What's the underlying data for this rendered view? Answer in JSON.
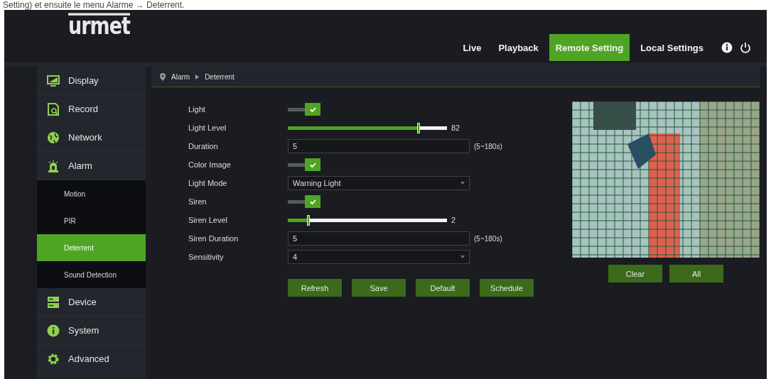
{
  "document_caption": "Setting) et ensuite le menu Alarme → Deterrent.",
  "header": {
    "logo": "urmet",
    "nav": [
      {
        "label": "Live",
        "selected": false
      },
      {
        "label": "Playback",
        "selected": false
      },
      {
        "label": "Remote Setting",
        "selected": true
      },
      {
        "label": "Local Settings",
        "selected": false
      }
    ]
  },
  "sidebar": {
    "items": [
      {
        "label": "Display",
        "selected": false
      },
      {
        "label": "Record",
        "selected": false
      },
      {
        "label": "Network",
        "selected": false
      },
      {
        "label": "Alarm",
        "selected": false,
        "expanded": true,
        "children": [
          {
            "label": "Motion",
            "selected": false
          },
          {
            "label": "PIR",
            "selected": false
          },
          {
            "label": "Deterrent",
            "selected": true
          },
          {
            "label": "Sound Detection",
            "selected": false
          }
        ]
      },
      {
        "label": "Device",
        "selected": false
      },
      {
        "label": "System",
        "selected": false
      },
      {
        "label": "Advanced",
        "selected": false
      }
    ]
  },
  "breadcrumb": [
    "Alarm",
    "Deterrent"
  ],
  "form": [
    {
      "label": "Light",
      "kind": "toggle",
      "checked": true
    },
    {
      "label": "Light Level",
      "kind": "slider",
      "level": 0.82,
      "reading": "82"
    },
    {
      "label": "Duration",
      "kind": "input",
      "value": "5",
      "suffix": "(5~180s)"
    },
    {
      "label": "Color Image",
      "kind": "toggle",
      "checked": true
    },
    {
      "label": "Light Mode",
      "kind": "select",
      "value": "Warning Light"
    },
    {
      "label": "Siren",
      "kind": "toggle",
      "checked": true
    },
    {
      "label": "Siren Level",
      "kind": "slider",
      "level": 0.13,
      "reading": "2"
    },
    {
      "label": "Siren Duration",
      "kind": "input",
      "value": "5",
      "suffix": "(5~180s)"
    },
    {
      "label": "Sensitivity",
      "kind": "select",
      "value": "4"
    }
  ],
  "actions": [
    "Refresh",
    "Save",
    "Default",
    "Schedule"
  ],
  "preview_buttons": [
    "Clear",
    "All"
  ]
}
